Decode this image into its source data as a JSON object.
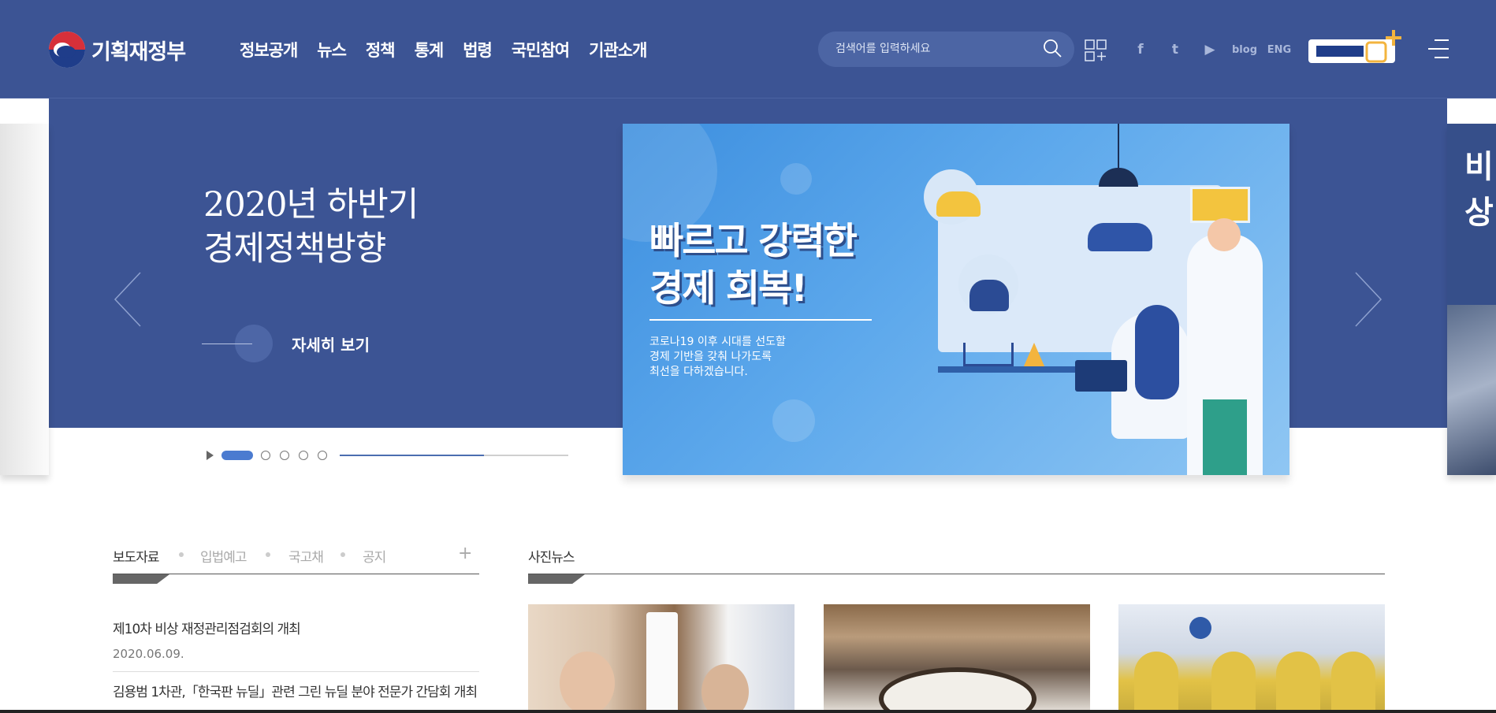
{
  "header": {
    "logo_text": "기획재정부",
    "nav": [
      "정보공개",
      "뉴스",
      "정책",
      "통계",
      "법령",
      "국민참여",
      "기관소개"
    ],
    "search_placeholder": "검색어를 입력하세요",
    "social": [
      "f",
      "t",
      "▶",
      "blog",
      "ENG"
    ]
  },
  "hero": {
    "title_line1": "2020년 하반기",
    "title_line2": "경제정책방향",
    "more_label": "자세히 보기",
    "slide_count": 5,
    "active_slide": 1,
    "progress_fraction": 0.63,
    "banner": {
      "title_line1": "빠르고 강력한",
      "title_line2": "경제 회복!",
      "sub_line1": "코로나19 이후 시대를 선도할",
      "sub_line2": "경제 기반을 갖춰 나가도록",
      "sub_line3": "최선을 다하겠습니다."
    },
    "right_peek_text": "비상"
  },
  "news": {
    "tabs": [
      "보도자료",
      "입법예고",
      "국고채",
      "공지"
    ],
    "active_tab": "보도자료",
    "more": "+",
    "items": [
      {
        "title": "제10차 비상 재정관리점검회의 개최",
        "date": "2020.06.09."
      },
      {
        "title": "김용범 1차관,「한국판 뉴딜」관련 그린 뉴딜 분야 전문가 간담회 개최",
        "date": ""
      }
    ]
  },
  "photo_news": {
    "title": "사진뉴스"
  },
  "colors": {
    "header_bg": "#3c5494",
    "accent_blue": "#4b7bd0",
    "banner_blue": "#5ea9ec"
  }
}
